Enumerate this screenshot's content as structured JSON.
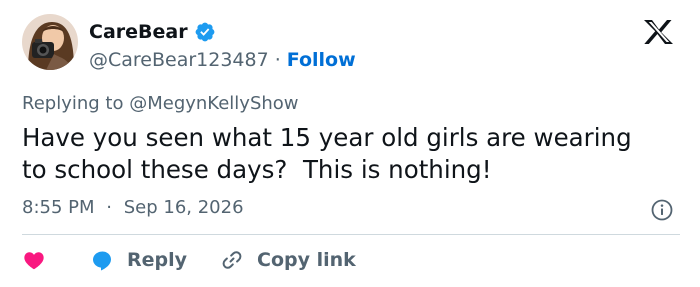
{
  "author": {
    "name": "CareBear",
    "handle": "@CareBear123487",
    "separator": "·",
    "follow_label": "Follow",
    "verified_color": "#1d9bf0"
  },
  "reply_context": {
    "prefix": "Replying to",
    "mention": "@MegynKellyShow"
  },
  "tweet": {
    "text": "Have you seen what 15 year old girls are wearing\nto school these days?  This is nothing!"
  },
  "meta": {
    "time": "8:55 PM",
    "separator": "·",
    "date": "Sep 16, 2026"
  },
  "actions": {
    "like_color": "#f91880",
    "reply_label": "Reply",
    "copy_link_label": "Copy link",
    "reply_color": "#1d9bf0"
  },
  "icons": {
    "logo": "x-logo-icon",
    "verified": "verified-badge-icon",
    "info": "info-icon",
    "like": "heart-icon",
    "reply": "reply-bubble-icon",
    "copy_link": "link-icon"
  }
}
